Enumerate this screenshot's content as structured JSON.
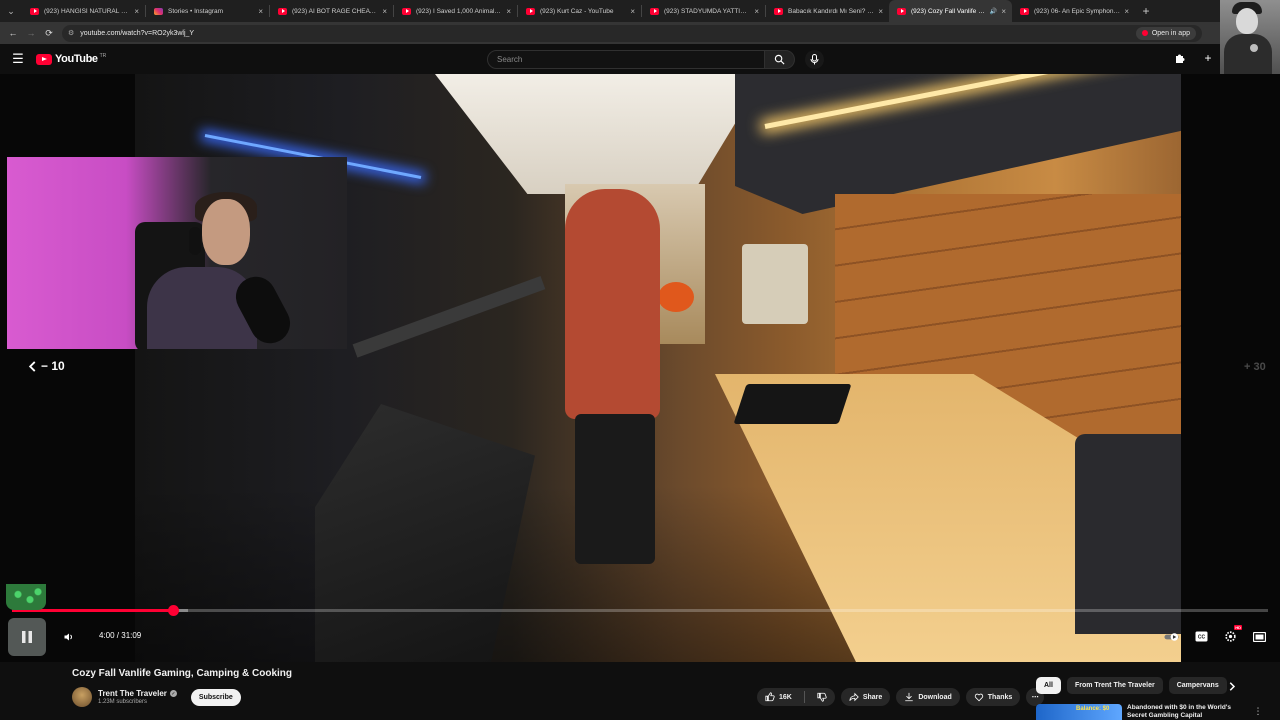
{
  "browser": {
    "tabs": [
      {
        "label": "(923) HANGİSİ NATURAL DEĞİL",
        "type": "youtube"
      },
      {
        "label": "Stories • Instagram",
        "type": "instagram"
      },
      {
        "label": "(923) AI BOT RAGE CHEATING",
        "type": "youtube"
      },
      {
        "label": "(923) I Saved 1,000 Animals Fr",
        "type": "youtube"
      },
      {
        "label": "(923) Kurt Caz - YouTube",
        "type": "youtube"
      },
      {
        "label": "(923) STADYUMDA YATTIĞIN Y",
        "type": "youtube"
      },
      {
        "label": "Babacık Kandırdı Mı Seni? - You",
        "type": "youtube"
      },
      {
        "label": "(923) Cozy Fall Vanlife Gam",
        "type": "youtube",
        "active": true
      },
      {
        "label": "(923) 06- An Epic Symphony #",
        "type": "youtube"
      }
    ],
    "url": "youtube.com/watch?v=RO2yk3wlj_Y",
    "open_in_app": "Open in app"
  },
  "yt_header": {
    "logo_text": "YouTube",
    "logo_country": "TR",
    "search_placeholder": "Search"
  },
  "player": {
    "seek_back_label": "− 10",
    "seek_fwd_label": "+ 30",
    "current_time": "4:00",
    "duration": "31:09",
    "time_display": "4:00 / 31:09",
    "progress_played_fraction": 0.1284,
    "progress_buffered_fraction": 0.14,
    "hd_badge": "HD",
    "accent_color": "#ff0033"
  },
  "video": {
    "title": "Cozy Fall Vanlife Gaming, Camping & Cooking",
    "channel_name": "Trent The Traveler",
    "subscribers": "1.23M subscribers",
    "subscribe_label": "Subscribe",
    "likes": "16K",
    "share_label": "Share",
    "download_label": "Download",
    "thanks_label": "Thanks"
  },
  "sidebar": {
    "chips": [
      "All",
      "From Trent The Traveler",
      "Campervans"
    ],
    "reco": {
      "thumb_text": "Balance: $0",
      "title": "Abandoned with $0 in the World's Secret Gambling Capital"
    }
  }
}
